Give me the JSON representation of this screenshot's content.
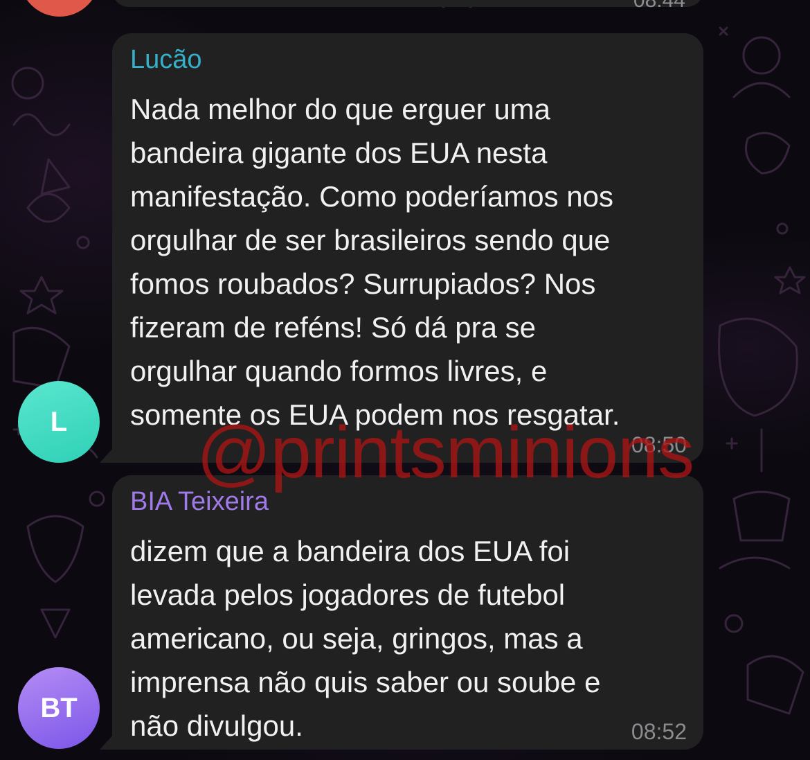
{
  "chat": {
    "previous_message": {
      "time": "08:44"
    },
    "messages": [
      {
        "sender": "Lucão",
        "sender_color": "#35b0c8",
        "avatar_initials": "L",
        "avatar_color": "#3fdcc2",
        "lines": [
          "Nada melhor do que erguer uma",
          "bandeira gigante dos EUA nesta",
          "manifestação. Como poderíamos nos",
          "orgulhar de ser brasileiros sendo que",
          "fomos roubados? Surrupiados? Nos",
          "fizeram de reféns! Só dá pra se",
          "orgulhar quando formos livres, e",
          "somente os EUA podem nos resgatar."
        ],
        "time": "08:50"
      },
      {
        "sender": "BIA Teixeira",
        "sender_color": "#a07ae8",
        "avatar_initials": "BT",
        "avatar_color": "#9a72ee",
        "lines": [
          "dizem que a bandeira dos EUA foi",
          "levada pelos jogadores de futebol",
          "americano, ou seja, gringos, mas a",
          "imprensa não quis saber ou soube e",
          "não divulgou."
        ],
        "time": "08:52"
      }
    ]
  },
  "watermark": {
    "text": "@printsminions",
    "color": "#aa1414"
  },
  "theme": {
    "background": "#0c0a10",
    "bubble": "#212121",
    "text": "#f1f1f1",
    "time": "#8c8c90"
  }
}
